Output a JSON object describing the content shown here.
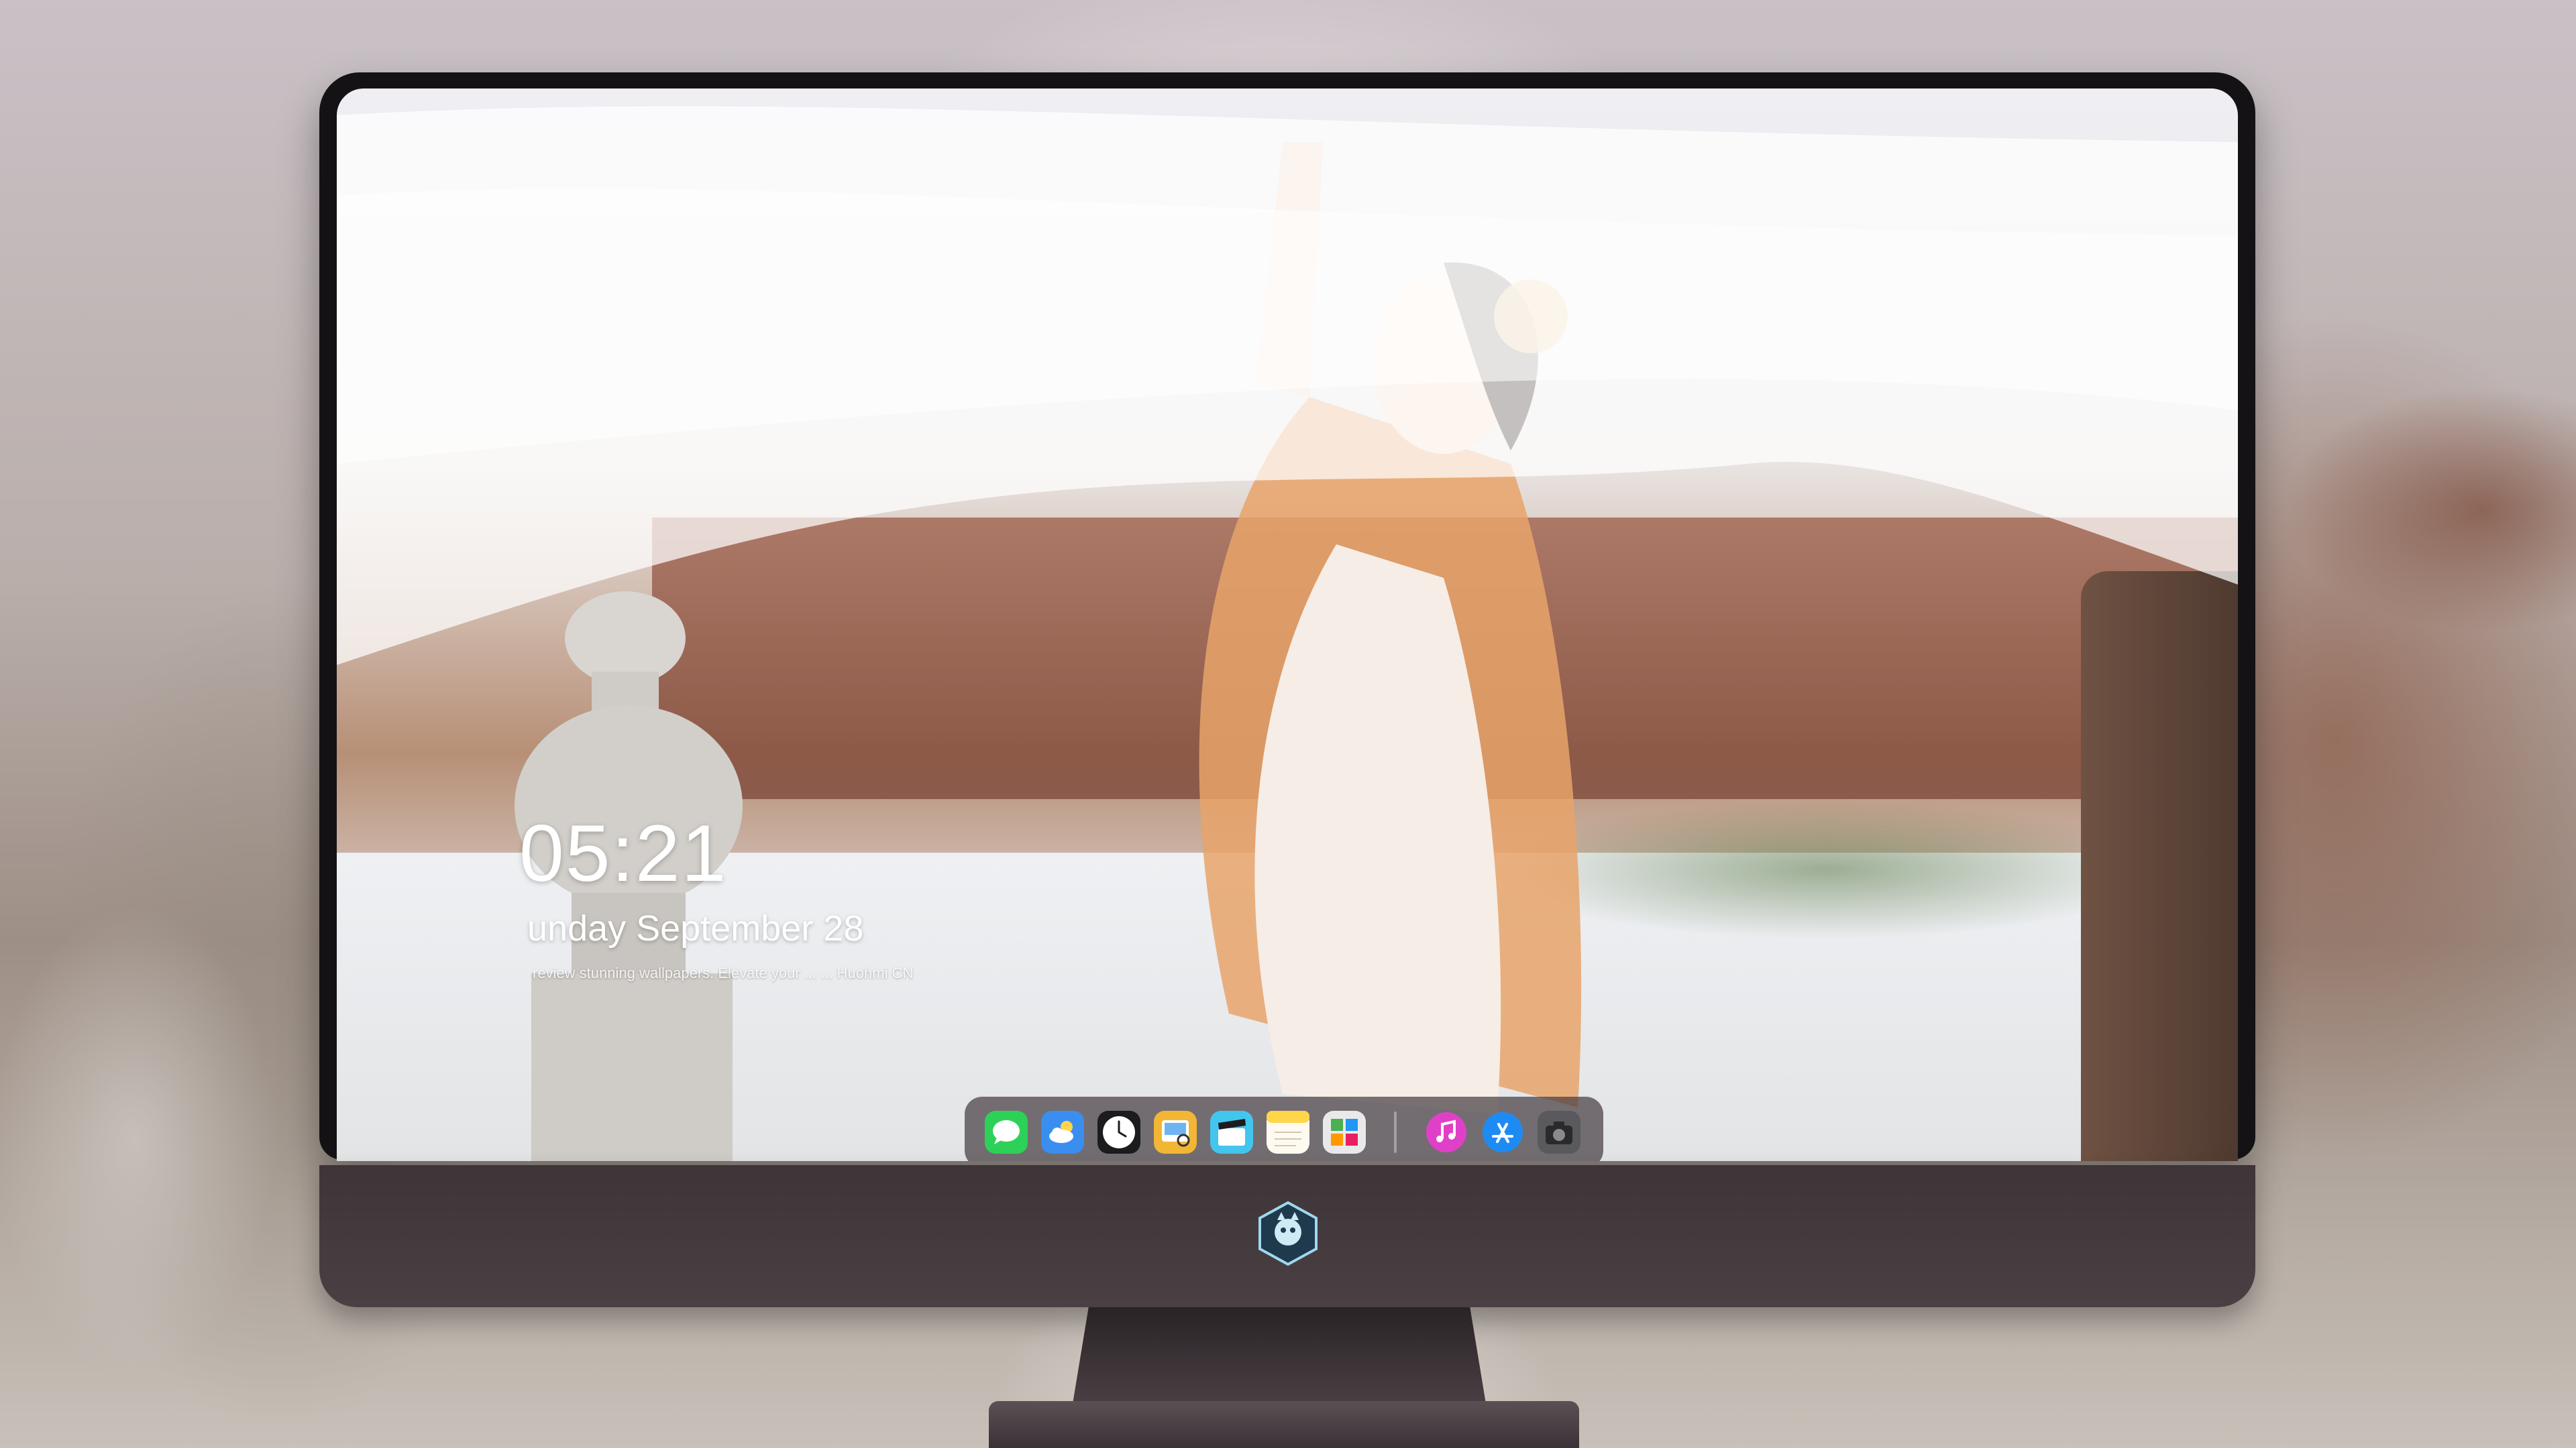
{
  "lock_screen": {
    "time": "05:21",
    "date": "unday September  28",
    "promo": "review stunning wallpapers. Elevate your ... ... Huohmi CN"
  },
  "dock": {
    "apps": [
      {
        "name": "Messages",
        "icon": "message-bubble-icon",
        "color": "#2ed158"
      },
      {
        "name": "Weather",
        "icon": "cloud-icon",
        "color": "#3a8ef0"
      },
      {
        "name": "Clock",
        "icon": "clock-icon",
        "color": "#1c1c1e"
      },
      {
        "name": "Preview",
        "icon": "photo-preview-icon",
        "color": "#f2b634"
      },
      {
        "name": "Clips",
        "icon": "clapperboard-icon",
        "color": "#43c6ee"
      },
      {
        "name": "Notes",
        "icon": "notes-icon",
        "color": "#ffd54a"
      },
      {
        "name": "Photo Booth",
        "icon": "photo-grid-icon",
        "color": "#e9e9ea"
      },
      {
        "name": "Music",
        "icon": "music-note-icon",
        "color": "#e040c8"
      },
      {
        "name": "App Store",
        "icon": "app-store-icon",
        "color": "#1e8bf5"
      },
      {
        "name": "Camera",
        "icon": "camera-icon",
        "color": "#5a5a5e"
      }
    ]
  },
  "colors": {
    "monitor_bezel": "#141214",
    "monitor_chin": "#3e3538",
    "dock_background": "#463e42"
  }
}
